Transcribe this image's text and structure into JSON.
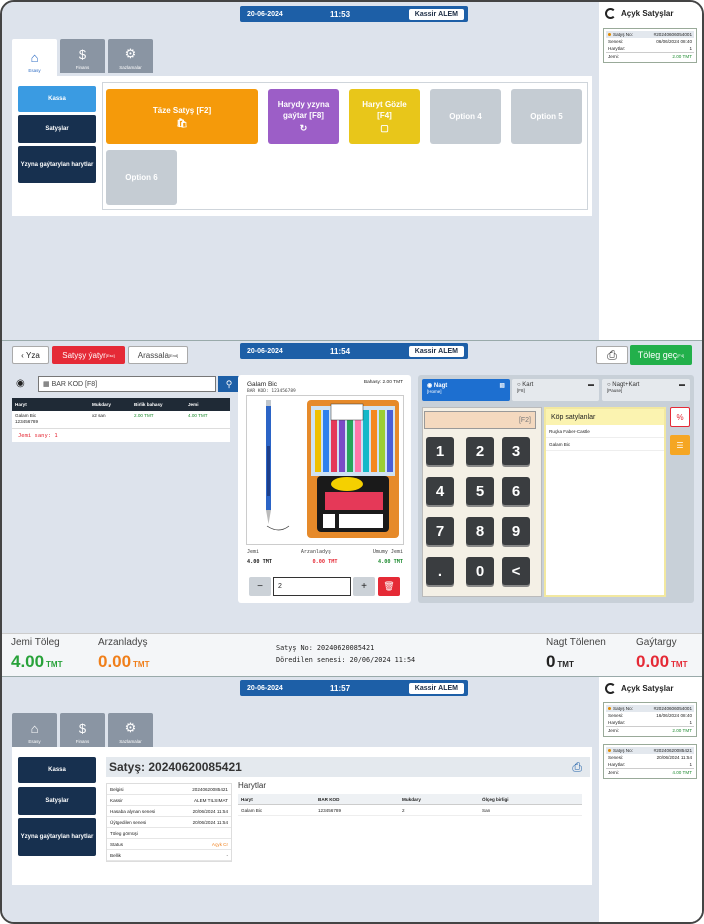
{
  "panel1": {
    "date": "20-06-2024",
    "time": "11:53",
    "user_label": "Kassir",
    "user_name": "ALEM",
    "nav": [
      {
        "label": "Esasy",
        "icon": "home-icon"
      },
      {
        "label": "Finans",
        "icon": "money-icon"
      },
      {
        "label": "Sazlamalar",
        "icon": "gear-icon"
      }
    ],
    "sidebar": [
      {
        "label": "Kassa"
      },
      {
        "label": "Satyşlar"
      },
      {
        "label": "Yzyna gaýtarylan harytlar"
      }
    ],
    "options": [
      {
        "label": "Täze Satyş [F2]",
        "icon": "bag-icon",
        "color": "#f59a0a"
      },
      {
        "label": "Harydy yzyna gaýtar [F8]",
        "icon": "return-icon",
        "color": "#9c5ec7"
      },
      {
        "label": "Haryt Gözle [F4]",
        "icon": "box-icon",
        "color": "#e8c61a"
      },
      {
        "label": "Option 4",
        "color": "#c5ccd3"
      },
      {
        "label": "Option 5",
        "color": "#c5ccd3"
      },
      {
        "label": "Option 6",
        "color": "#c5ccd3"
      }
    ],
    "open_sales": {
      "title": "Açyk Satyşlar",
      "orders": [
        {
          "sale_no_label": "Satyş No:",
          "sale_no": "#20240606054001",
          "date_label": "Senesi:",
          "date": "06/06/2024 08:40",
          "items_label": "Harytlar:",
          "items": "1",
          "total_label": "Jemi:",
          "total": "2.00 TMT"
        }
      ]
    }
  },
  "panel2": {
    "date": "20-06-2024",
    "time": "11:54",
    "user_label": "Kassir",
    "user_name": "ALEM",
    "back_label": "Yza",
    "cancel_sale_label": "Satyşy ýatyr",
    "cancel_sale_key": "[Esc]",
    "clear_label": "Arassala",
    "clear_key": "[End]",
    "pay_label": "Töleg geç",
    "pay_key": "[F4]",
    "barcode_placeholder": "BAR KOD [F8]",
    "cart_headers": [
      "Haryt",
      "Mukdary",
      "Birlik bahasy",
      "Jemi"
    ],
    "cart_rows": [
      {
        "name": "Galam Bic",
        "code": "123456789",
        "qty": "x2 san",
        "price": "2.00 TMT",
        "total": "4.00 TMT"
      }
    ],
    "total_count": "Jemi sany: 1",
    "product": {
      "name": "Galam Bic",
      "barcode": "BAR KOD: 123456789",
      "price": "Bahasy: 2.00 TMT",
      "col_labels": [
        "Jemi",
        "Arzanladyş",
        "Umumy Jemi"
      ],
      "col_values": [
        "4.00 TMT",
        "0.00 TMT",
        "4.00 TMT"
      ],
      "qty": "2",
      "minus": "−",
      "plus": "+"
    },
    "pay_methods": [
      {
        "label": "Nagt",
        "key": "[Home]"
      },
      {
        "label": "Kart",
        "key": "[F8]"
      },
      {
        "label": "Nagt+Kart",
        "key": "[Pause]"
      }
    ],
    "pad_display": "[F2]",
    "keys": [
      "1",
      "2",
      "3",
      "4",
      "5",
      "6",
      "7",
      "8",
      "9",
      ".",
      "0",
      "<"
    ],
    "frequent": {
      "title": "Köp satylanlar",
      "items": [
        "Ruçka Faber-Castle",
        "Galam Bic"
      ]
    },
    "footer": {
      "total_label": "Jemi Töleg",
      "total_value": "4.00",
      "discount_label": "Arzanladyş",
      "discount_value": "0.00",
      "currency": "TMT",
      "sale_no": "Satyş No: 20240620085421",
      "created": "Döredilen senesi: 20/06/2024 11:54",
      "cash_label": "Nagt Tölenen",
      "cash_value": "0",
      "change_label": "Gaýtargy",
      "change_value": "0.00"
    }
  },
  "panel3": {
    "date": "20-06-2024",
    "time": "11:57",
    "user_label": "Kassir",
    "user_name": "ALEM",
    "nav": [
      {
        "label": "Esasy"
      },
      {
        "label": "Finans"
      },
      {
        "label": "Sazlamalar"
      }
    ],
    "sidebar": [
      {
        "label": "Kassa"
      },
      {
        "label": "Satyşlar"
      },
      {
        "label": "Yzyna gaýtarylan harytlar"
      }
    ],
    "sale_title": "Satyş: 20240620085421",
    "details": [
      {
        "k": "Belgisi",
        "v": "20240620085421"
      },
      {
        "k": "Kassir",
        "v": "ALEM TILSIMAT"
      },
      {
        "k": "Hasaba alynan senesi",
        "v": "20/06/2024 11:54"
      },
      {
        "k": "Üýtgedilen senesi",
        "v": "20/06/2024 11:54"
      },
      {
        "k": "Töleg görnüşi",
        "v": ""
      },
      {
        "k": "Status",
        "v": "Açyk Cr"
      },
      {
        "k": "Bellik",
        "v": "-"
      }
    ],
    "items_title": "Harytlar",
    "items_headers": [
      "Haryt",
      "BAR KOD",
      "Mukdary",
      "Ölçeg birligi"
    ],
    "items_rows": [
      {
        "name": "Galam Bic",
        "code": "123456789",
        "qty": "2",
        "unit": "San"
      }
    ],
    "open_sales": {
      "title": "Açyk Satyşlar",
      "orders": [
        {
          "sale_no_label": "Satyş No:",
          "sale_no": "#20240606054001",
          "date_label": "Senesi:",
          "date": "16/06/2024 08:40",
          "items_label": "Harytlar:",
          "items": "1",
          "total_label": "Jemi:",
          "total": "2.00 TMT"
        },
        {
          "sale_no_label": "Satyş No:",
          "sale_no": "#20240620085421",
          "date_label": "Senesi:",
          "date": "20/06/2024 11:54",
          "items_label": "Harytlar:",
          "items": "1",
          "total_label": "Jemi:",
          "total": "4.00 TMT"
        }
      ]
    }
  }
}
